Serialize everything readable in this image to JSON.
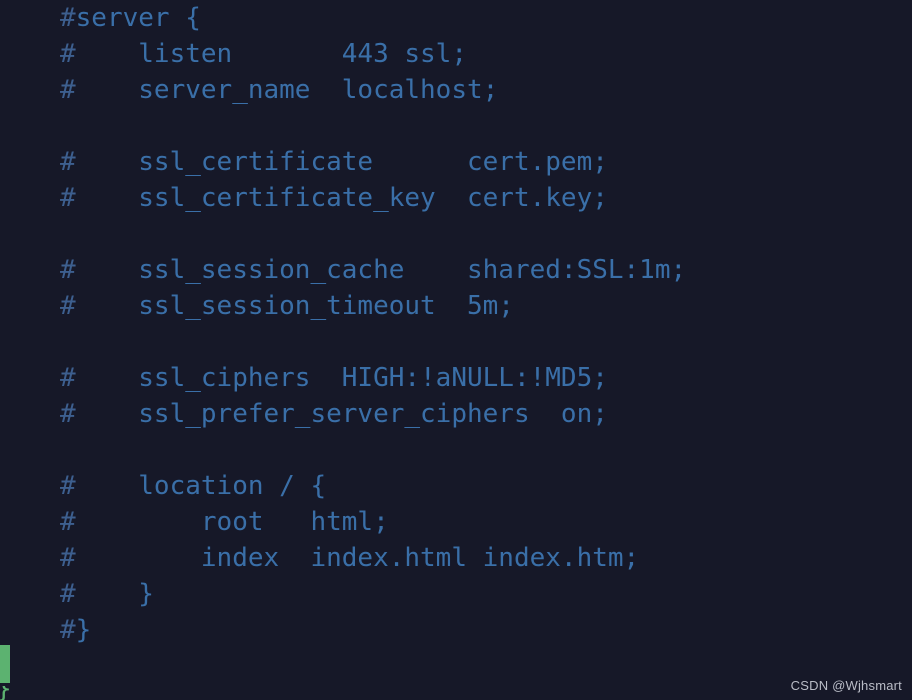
{
  "editor": {
    "background_color": "#161828",
    "code_color": "#3a6fa8",
    "comment_marker_color": "#3d5f8f",
    "accent_green": "#5cb270",
    "language": "nginx",
    "lines": [
      {
        "marker": "#",
        "text": "server {"
      },
      {
        "marker": "#",
        "text": "    listen       443 ssl;"
      },
      {
        "marker": "#",
        "text": "    server_name  localhost;"
      },
      {
        "marker": "",
        "text": ""
      },
      {
        "marker": "#",
        "text": "    ssl_certificate      cert.pem;"
      },
      {
        "marker": "#",
        "text": "    ssl_certificate_key  cert.key;"
      },
      {
        "marker": "",
        "text": ""
      },
      {
        "marker": "#",
        "text": "    ssl_session_cache    shared:SSL:1m;"
      },
      {
        "marker": "#",
        "text": "    ssl_session_timeout  5m;"
      },
      {
        "marker": "",
        "text": ""
      },
      {
        "marker": "#",
        "text": "    ssl_ciphers  HIGH:!aNULL:!MD5;"
      },
      {
        "marker": "#",
        "text": "    ssl_prefer_server_ciphers  on;"
      },
      {
        "marker": "",
        "text": ""
      },
      {
        "marker": "#",
        "text": "    location / {"
      },
      {
        "marker": "#",
        "text": "        root   html;"
      },
      {
        "marker": "#",
        "text": "        index  index.html index.htm;"
      },
      {
        "marker": "#",
        "text": "    }"
      },
      {
        "marker": "#",
        "text": "}"
      }
    ]
  },
  "artifacts": {
    "green_glyph_char": "}"
  },
  "watermark": {
    "text": "CSDN @Wjhsmart"
  }
}
